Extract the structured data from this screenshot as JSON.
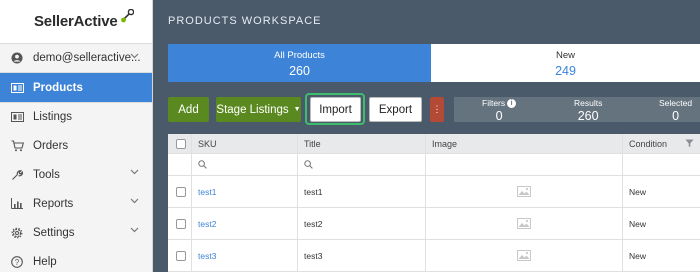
{
  "brand": {
    "name": "SellerActive"
  },
  "sidebar": {
    "user": "demo@selleractive...",
    "items": [
      {
        "label": "Products",
        "icon": "products-icon",
        "active": true
      },
      {
        "label": "Listings",
        "icon": "listings-icon"
      },
      {
        "label": "Orders",
        "icon": "cart-icon"
      },
      {
        "label": "Tools",
        "icon": "wrench-icon",
        "expandable": true
      },
      {
        "label": "Reports",
        "icon": "chart-icon",
        "expandable": true
      },
      {
        "label": "Settings",
        "icon": "gear-icon",
        "expandable": true
      },
      {
        "label": "Help",
        "icon": "help-icon"
      }
    ]
  },
  "workspace": {
    "title": "PRODUCTS WORKSPACE"
  },
  "tabs": [
    {
      "label": "All Products",
      "count": "260"
    },
    {
      "label": "New",
      "count": "249"
    }
  ],
  "toolbar": {
    "add": "Add",
    "stage": "Stage Listings",
    "import": "Import",
    "export": "Export",
    "more": "⋮"
  },
  "stats": {
    "filters_label": "Filters",
    "filters_value": "0",
    "results_label": "Results",
    "results_value": "260",
    "selected_label": "Selected",
    "selected_value": "0"
  },
  "table": {
    "columns": [
      "SKU",
      "Title",
      "Image",
      "Condition"
    ],
    "rows": [
      {
        "sku": "test1",
        "title": "test1",
        "condition": "New"
      },
      {
        "sku": "test2",
        "title": "test2",
        "condition": "New"
      },
      {
        "sku": "test3",
        "title": "test3",
        "condition": "New"
      }
    ]
  },
  "colors": {
    "accent": "#3d84d8",
    "action_green": "#5a8a1f",
    "highlight_outline": "#3dbd6d",
    "danger": "#b24a36",
    "workspace_bg": "#4a5a6a"
  }
}
